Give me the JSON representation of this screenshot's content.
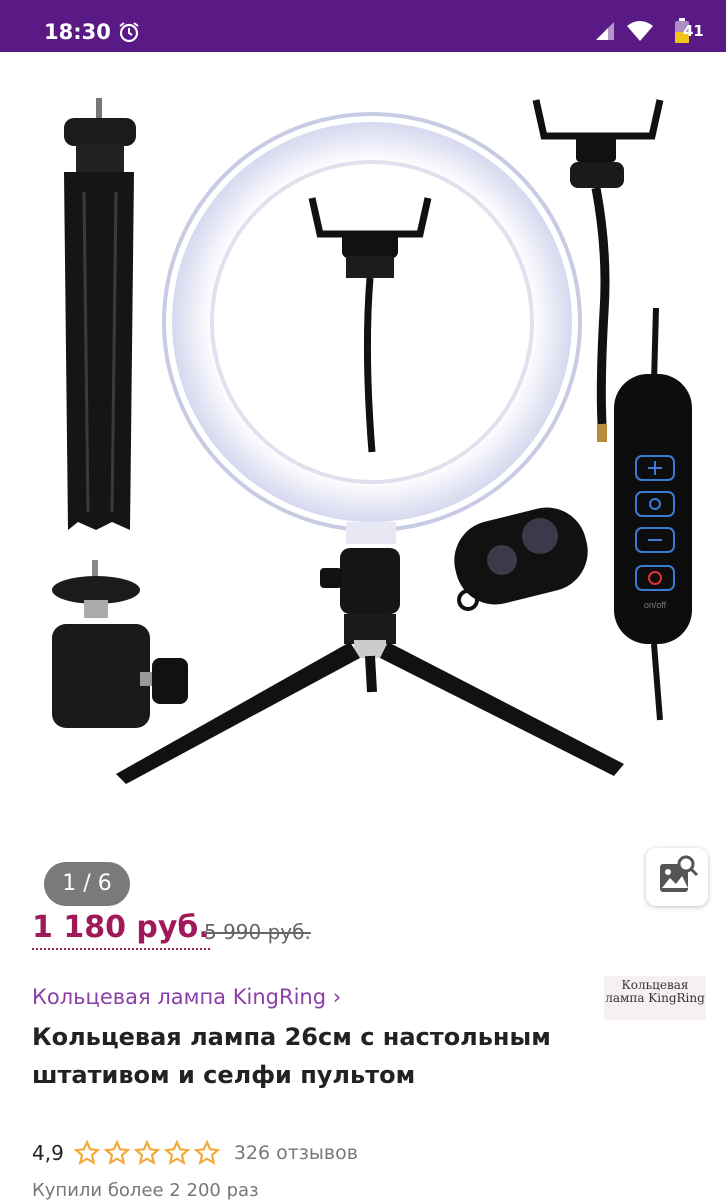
{
  "status_bar": {
    "time": "18:30",
    "battery": "41"
  },
  "gallery": {
    "counter": "1 / 6"
  },
  "price": {
    "current": "1 180 руб.",
    "old": "5 990 руб."
  },
  "brand": {
    "link": "Кольцевая лампа KingRing ›",
    "logo_text": "Кольцевая лампа KingRing"
  },
  "product": {
    "title": "Кольцевая лампа 26см с настольным штативом и селфи пультом",
    "rating": "4,9",
    "stars": 5,
    "reviews": "326 отзывов",
    "bought": "Купили более 2 200 раз",
    "remote_label": "on/off"
  },
  "colors": {
    "statusbar": "#5a1a86",
    "price": "#a01a5a",
    "brand": "#8a3fa9",
    "star": "#f3a93a"
  }
}
